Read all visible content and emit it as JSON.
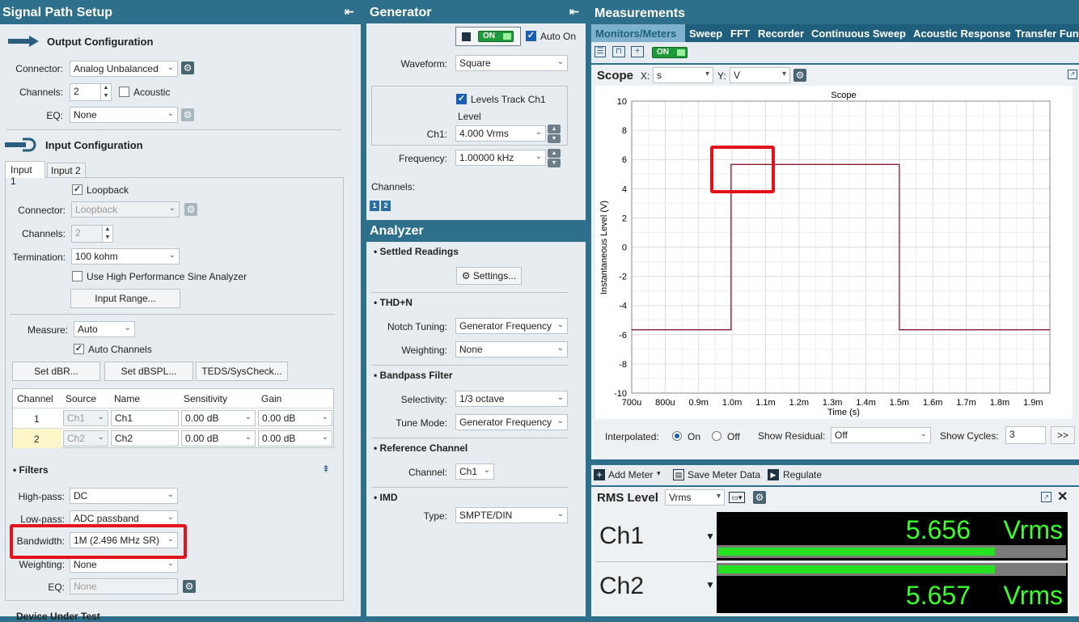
{
  "signal_path": {
    "title": "Signal Path Setup",
    "pin": "⇤",
    "output": {
      "title": "Output Configuration",
      "connector_label": "Connector:",
      "connector": "Analog Unbalanced",
      "channels_label": "Channels:",
      "channels": "2",
      "acoustic": "Acoustic",
      "eq_label": "EQ:",
      "eq": "None"
    },
    "input": {
      "title": "Input Configuration",
      "tabs": [
        "Input 1",
        "Input 2"
      ],
      "loopback": "Loopback",
      "connector_label": "Connector:",
      "connector": "Loopback",
      "channels_label": "Channels:",
      "channels": "2",
      "termination_label": "Termination:",
      "termination": "100 kohm",
      "hp_sine": "Use High Performance Sine Analyzer",
      "input_range": "Input Range...",
      "measure_label": "Measure:",
      "measure": "Auto",
      "auto_channels": "Auto Channels",
      "set_dbr": "Set dBR...",
      "set_dbspl": "Set dBSPL...",
      "teds": "TEDS/SysCheck...",
      "table": {
        "headers": [
          "Channel",
          "Source",
          "Name",
          "Sensitivity",
          "Gain"
        ],
        "rows": [
          [
            "1",
            "Ch1",
            "Ch1",
            "0.00 dB",
            "0.00 dB"
          ],
          [
            "2",
            "Ch2",
            "Ch2",
            "0.00 dB",
            "0.00 dB"
          ]
        ]
      }
    },
    "filters": {
      "title": "• Filters",
      "highpass_label": "High-pass:",
      "highpass": "DC",
      "lowpass_label": "Low-pass:",
      "lowpass": "ADC passband",
      "bandwidth_label": "Bandwidth:",
      "bandwidth": "1M (2.496 MHz SR)",
      "weighting_label": "Weighting:",
      "weighting": "None",
      "eq_label": "EQ:",
      "eq": "None"
    },
    "bottom_cut": "Device Under Test"
  },
  "generator": {
    "title": "Generator",
    "on": "ON",
    "auto_on": "Auto On",
    "waveform_label": "Waveform:",
    "waveform": "Square",
    "levels_track": "Levels Track Ch1",
    "level_label": "Level",
    "ch1_label": "Ch1:",
    "ch1": "4.000 Vrms",
    "frequency_label": "Frequency:",
    "frequency": "1.00000 kHz",
    "channels_label": "Channels:",
    "ch_badges": [
      "1",
      "2"
    ]
  },
  "analyzer": {
    "title": "Analyzer",
    "settled": "• Settled Readings",
    "settings": "Settings...",
    "thdn": "• THD+N",
    "notch_label": "Notch Tuning:",
    "notch": "Generator Frequency",
    "weighting_label": "Weighting:",
    "weighting": "None",
    "bandpass": "• Bandpass Filter",
    "selectivity_label": "Selectivity:",
    "selectivity": "1/3 octave",
    "tune_label": "Tune Mode:",
    "tune": "Generator Frequency",
    "ref": "• Reference Channel",
    "channel_label": "Channel:",
    "channel": "Ch1",
    "imd": "• IMD",
    "type_label": "Type:",
    "type": "SMPTE/DIN"
  },
  "measurements": {
    "title": "Measurements",
    "tabs": [
      "Monitors/Meters",
      "Sweep",
      "FFT",
      "Recorder",
      "Continuous Sweep",
      "Acoustic Response",
      "Transfer Func"
    ],
    "on": "ON",
    "scope": {
      "title": "Scope",
      "x_label": "X:",
      "x": "s",
      "y_label": "Y:",
      "y": "V",
      "interpolated_label": "Interpolated:",
      "on": "On",
      "off": "Off",
      "show_residual_label": "Show Residual:",
      "show_residual": "Off",
      "show_cycles_label": "Show Cycles:",
      "show_cycles": "3",
      "more": ">>"
    },
    "toolbar": {
      "add_meter": "Add Meter",
      "save_meter": "Save Meter Data",
      "regulate": "Regulate"
    },
    "rms": {
      "title": "RMS Level",
      "unit_select": "Vrms",
      "rows": [
        {
          "ch": "Ch1",
          "value": "5.656",
          "unit": "Vrms",
          "level": 0.8
        },
        {
          "ch": "Ch2",
          "value": "5.657",
          "unit": "Vrms",
          "level": 0.8
        }
      ]
    }
  },
  "chart_data": {
    "type": "line",
    "title": "Scope",
    "xlabel": "Time (s)",
    "ylabel": "Instantaneous Level (V)",
    "x_ticks": [
      "700u",
      "800u",
      "0.9m",
      "1.0m",
      "1.1m",
      "1.2m",
      "1.3m",
      "1.4m",
      "1.5m",
      "1.6m",
      "1.7m",
      "1.8m",
      "1.9m"
    ],
    "y_ticks": [
      "10",
      "8",
      "6",
      "4",
      "2",
      "0",
      "-2",
      "-4",
      "-6",
      "-8",
      "-10"
    ],
    "xlim": [
      0.0007,
      0.00195
    ],
    "ylim": [
      -10,
      10
    ],
    "grid": true,
    "series": [
      {
        "color": "#8b1a2e",
        "x": [
          0.0007,
          0.000997,
          0.000997,
          0.0015,
          0.0015,
          0.00195
        ],
        "y": [
          -5.66,
          -5.66,
          5.66,
          5.66,
          -5.66,
          -5.66
        ]
      }
    ]
  }
}
